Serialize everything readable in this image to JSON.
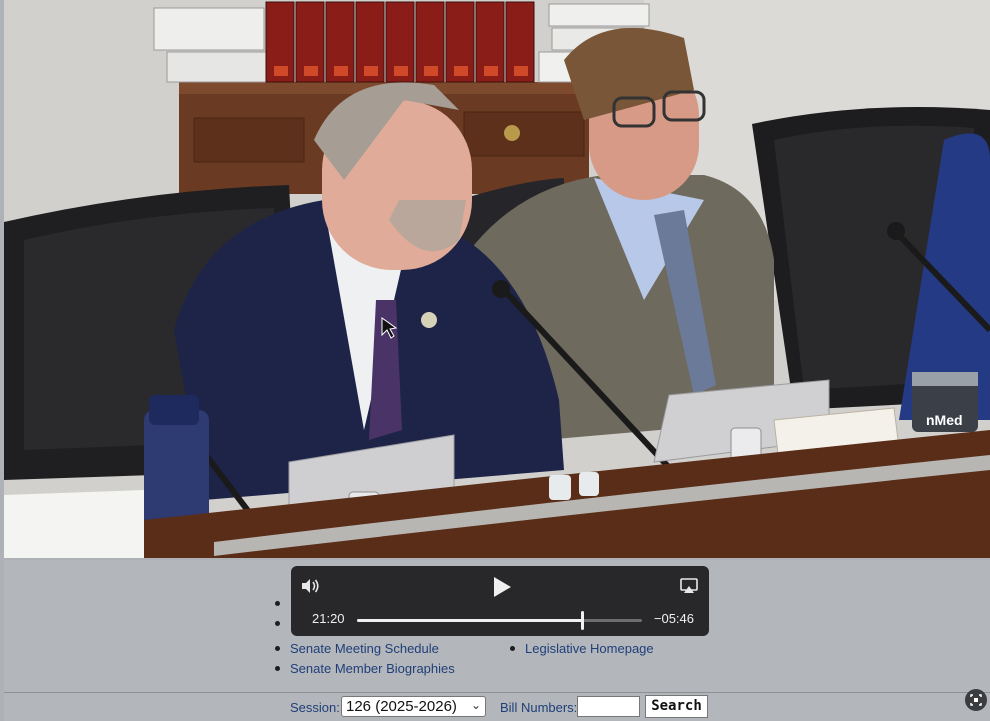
{
  "video": {
    "badge_text": "nMed"
  },
  "controls": {
    "volume_icon": "volume-icon",
    "play_icon": "play-icon",
    "airplay_icon": "airplay-icon",
    "current_time": "21:20",
    "remaining_time": "−05:46",
    "progress": 0.79
  },
  "links": {
    "left": [
      "Senate Meeting Schedule",
      "Senate Member Biographies"
    ],
    "right": [
      "Legislative Homepage"
    ]
  },
  "session_bar": {
    "session_label": "Session:",
    "session_value": "126 (2025-2026)",
    "bill_label": "Bill Numbers:",
    "bill_value": "",
    "search_label": "Search"
  }
}
